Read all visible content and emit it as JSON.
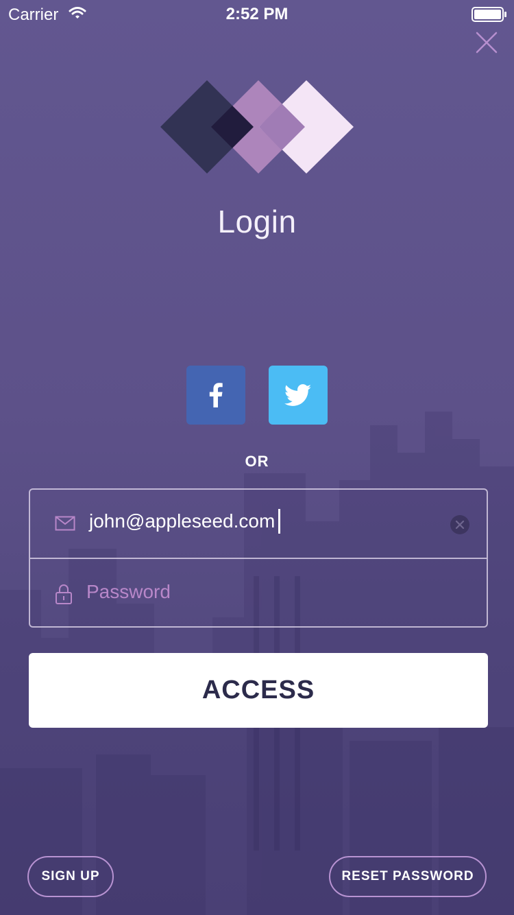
{
  "status_bar": {
    "carrier": "Carrier",
    "time": "2:52 PM",
    "icons": [
      "wifi-icon",
      "battery-icon"
    ]
  },
  "header": {
    "close_icon": "close-icon",
    "logo_icon": "logo-diamonds-icon",
    "title": "Login"
  },
  "social": {
    "facebook_icon": "facebook-icon",
    "twitter_icon": "twitter-icon",
    "facebook_color": "#4465b2",
    "twitter_color": "#4bbcf4",
    "separator": "OR"
  },
  "form": {
    "email_value": "john@appleseed.com",
    "email_icon": "mail-icon",
    "clear_icon": "clear-icon",
    "password_placeholder": "Password",
    "password_icon": "lock-icon"
  },
  "actions": {
    "access_label": "ACCESS",
    "sign_up_label": "SIGN UP",
    "reset_password_label": "RESET PASSWORD"
  },
  "colors": {
    "background": "#5d5289",
    "accent": "#b893d2",
    "button_text": "#2c2b4b"
  }
}
